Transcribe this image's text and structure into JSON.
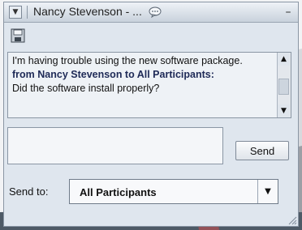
{
  "window": {
    "title": "Nancy Stevenson - ...",
    "collapse_icon": "triangle-down-icon",
    "chat_icon": "speech-bubble-icon",
    "minimize_symbol": "–"
  },
  "toolbar": {
    "save_icon": "floppy-disk-icon"
  },
  "messages": [
    {
      "header": "",
      "text": "I'm having trouble using the new software package."
    },
    {
      "header": "from Nancy Stevenson to All Participants:",
      "text": "Did the software install properly?"
    }
  ],
  "compose": {
    "value": "",
    "send_label": "Send"
  },
  "send_to": {
    "label": "Send to:",
    "selected": "All Participants"
  },
  "colors": {
    "panel_bg": "#dfe6ee",
    "header_text": "#1e2a57"
  }
}
